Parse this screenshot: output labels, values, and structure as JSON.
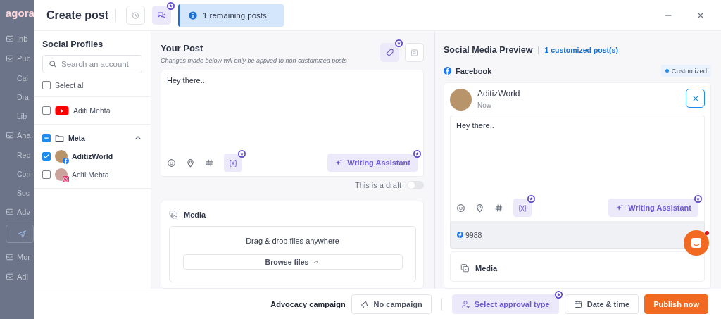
{
  "background_app": {
    "logo": "agora",
    "nav": [
      {
        "label": "Inb"
      },
      {
        "label": "Pub",
        "children": [
          {
            "label": "Cal"
          },
          {
            "label": "Dra"
          },
          {
            "label": "Lib"
          }
        ]
      },
      {
        "label": "Ana",
        "children": [
          {
            "label": "Rep"
          },
          {
            "label": "Con"
          },
          {
            "label": "Soc"
          }
        ]
      },
      {
        "label": "Adv"
      },
      {
        "label": "Mor"
      },
      {
        "label": "Adi"
      }
    ]
  },
  "header": {
    "title": "Create post",
    "banner": "1 remaining posts"
  },
  "profiles": {
    "title": "Social Profiles",
    "search": {
      "placeholder": "Search an account"
    },
    "select_all": {
      "label": "Select all",
      "checked": false
    },
    "accounts": [
      {
        "name": "Aditi Mehta",
        "kind": "youtube",
        "checked": false
      }
    ],
    "group": {
      "name": "Meta",
      "indeterminate": true,
      "expanded": true,
      "children": [
        {
          "name": "AditizWorld",
          "kind": "facebook",
          "checked": true
        },
        {
          "name": "Aditi Mehta",
          "kind": "instagram",
          "checked": false
        }
      ]
    }
  },
  "post": {
    "title": "Your Post",
    "note": "Changes made below will only be applied to non customized posts",
    "text": "Hey there..",
    "variable_button": "{x}",
    "writing_assistant": "Writing Assistant",
    "draft": {
      "label": "This is a draft",
      "on": false
    },
    "media": {
      "title": "Media",
      "drop_text": "Drag & drop files anywhere",
      "browse": "Browse files"
    }
  },
  "preview": {
    "title": "Social Media Preview",
    "customized_link": "1 customized post(s)",
    "network": "Facebook",
    "badge": "Customized",
    "card": {
      "name": "AditizWorld",
      "time": "Now",
      "text": "Hey there..",
      "variable_button": "{x}",
      "writing_assistant": "Writing Assistant",
      "reach": "9988"
    },
    "media_title": "Media"
  },
  "footer": {
    "campaign_label": "Advocacy campaign",
    "campaign": "No campaign",
    "approval": "Select approval type",
    "datetime": "Date & time",
    "publish": "Publish now"
  }
}
